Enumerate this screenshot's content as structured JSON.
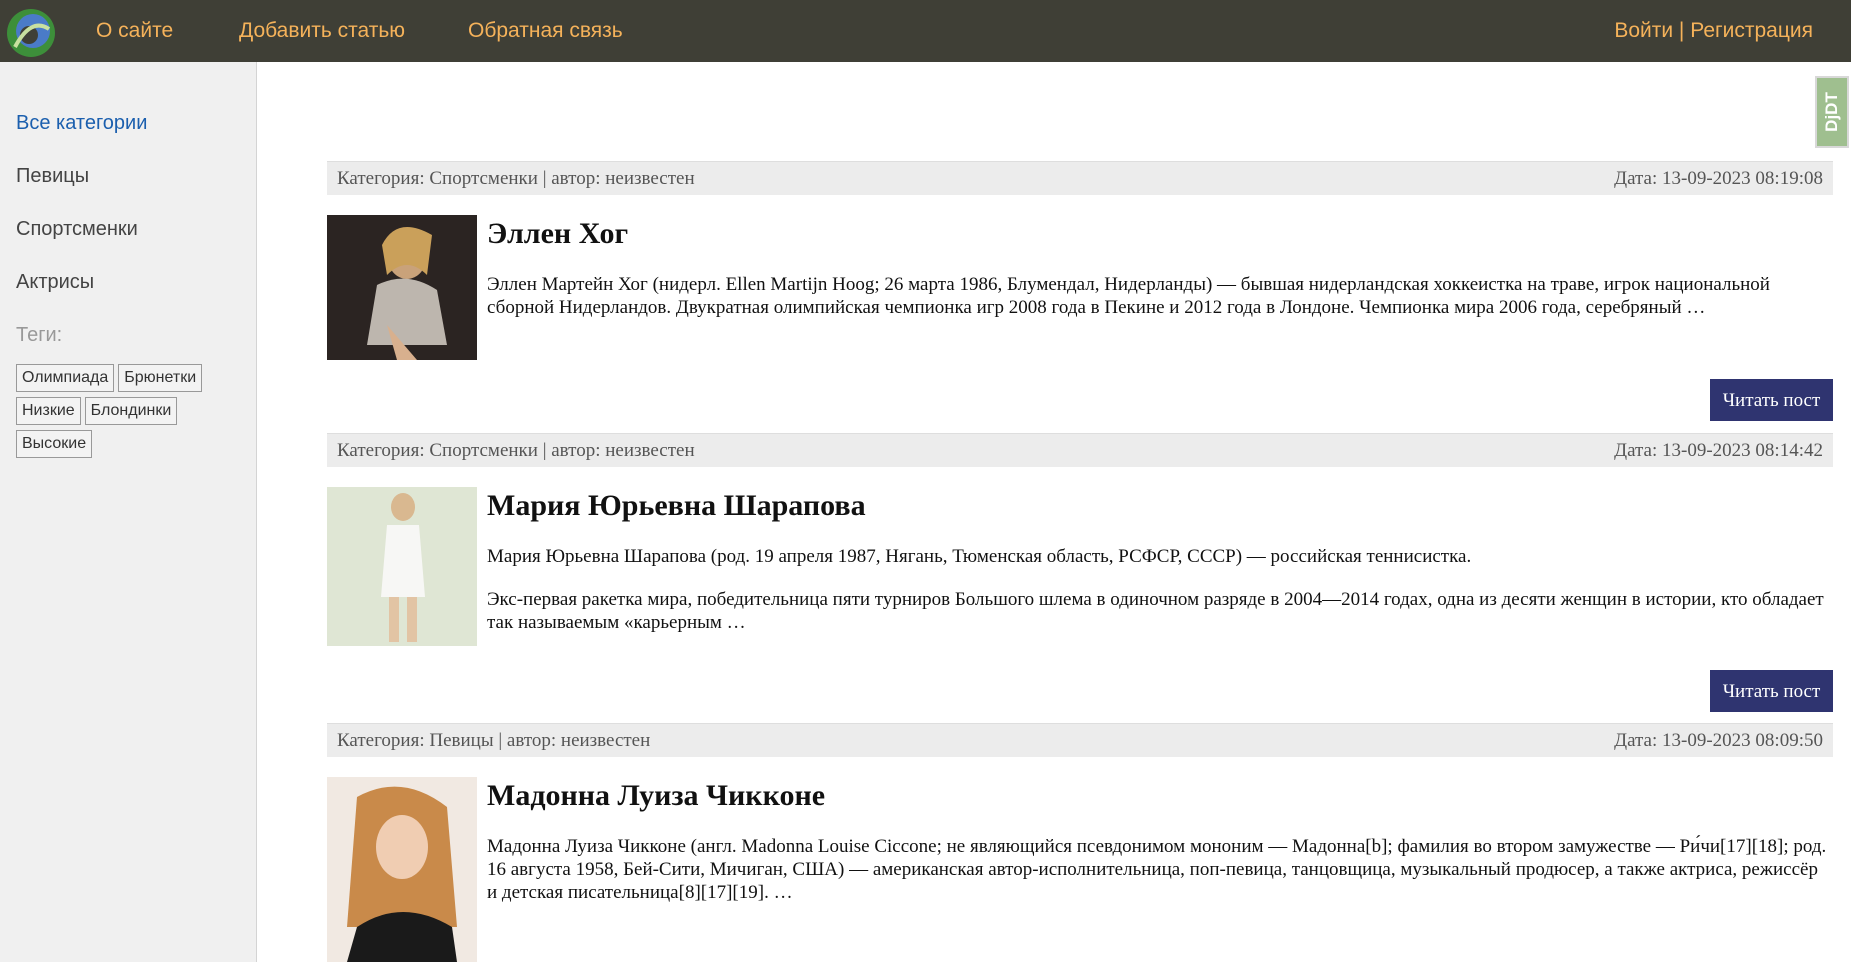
{
  "header": {
    "nav": [
      "О сайте",
      "Добавить статью",
      "Обратная связь"
    ],
    "login": "Войти",
    "separator": "|",
    "register": "Регистрация",
    "accent_color": "#f5b25a",
    "bg_color": "#3f3f36"
  },
  "sidebar": {
    "all_categories": "Все категории",
    "categories": [
      "Певицы",
      "Спортсменки",
      "Актрисы"
    ],
    "tags_title": "Теги:",
    "tags": [
      "Олимпиада",
      "Брюнетки",
      "Низкие",
      "Блондинки",
      "Высокие"
    ]
  },
  "badge": {
    "label": "DjDT"
  },
  "posts": [
    {
      "meta": "Категория: Спортсменки | автор: неизвестен",
      "date": "Дата: 13-09-2023 08:19:08",
      "title": "Эллен Хог",
      "paragraphs": [
        "Эллен Мартейн Хог (нидерл. Ellen Martijn Hoog; 26 марта 1986, Блумендал, Нидерланды) — бывшая нидерландская хоккеистка на траве, игрок национальной сборной Нидерландов. Двукратная олимпийская чемпионка игр 2008 года в Пекине и 2012 года в Лондоне. Чемпионка мира 2006 года, серебряный …"
      ],
      "button": "Читать пост"
    },
    {
      "meta": "Категория: Спортсменки | автор: неизвестен",
      "date": "Дата: 13-09-2023 08:14:42",
      "title": "Мария Юрьевна Шарапова",
      "paragraphs": [
        "Мария Юрьевна Шарапова (род. 19 апреля 1987, Нягань, Тюменская область, РСФСР, СССР) — российская теннисистка.",
        "Экс-первая ракетка мира, победительница пяти турниров Большого шлема в одиночном разряде в 2004—2014 годах, одна из десяти женщин в истории, кто обладает так называемым «карьерным …"
      ],
      "button": "Читать пост"
    },
    {
      "meta": "Категория: Певицы | автор: неизвестен",
      "date": "Дата: 13-09-2023 08:09:50",
      "title": "Мадонна Луиза Чикконе",
      "paragraphs": [
        "Мадонна Луиза Чикконе (англ. Madonna Louise Ciccone; не являющийся псевдонимом мононим — Мадонна[b]; фамилия во втором замужестве — Ри́чи[17][18]; род. 16 августа 1958, Бей-Сити, Мичиган, США) — американская автор-исполнительница, поп-певица, танцовщица, музыкальный продюсер, а также актриса, режиссёр и детская писательница[8][17][19]. …"
      ],
      "button": ""
    }
  ]
}
